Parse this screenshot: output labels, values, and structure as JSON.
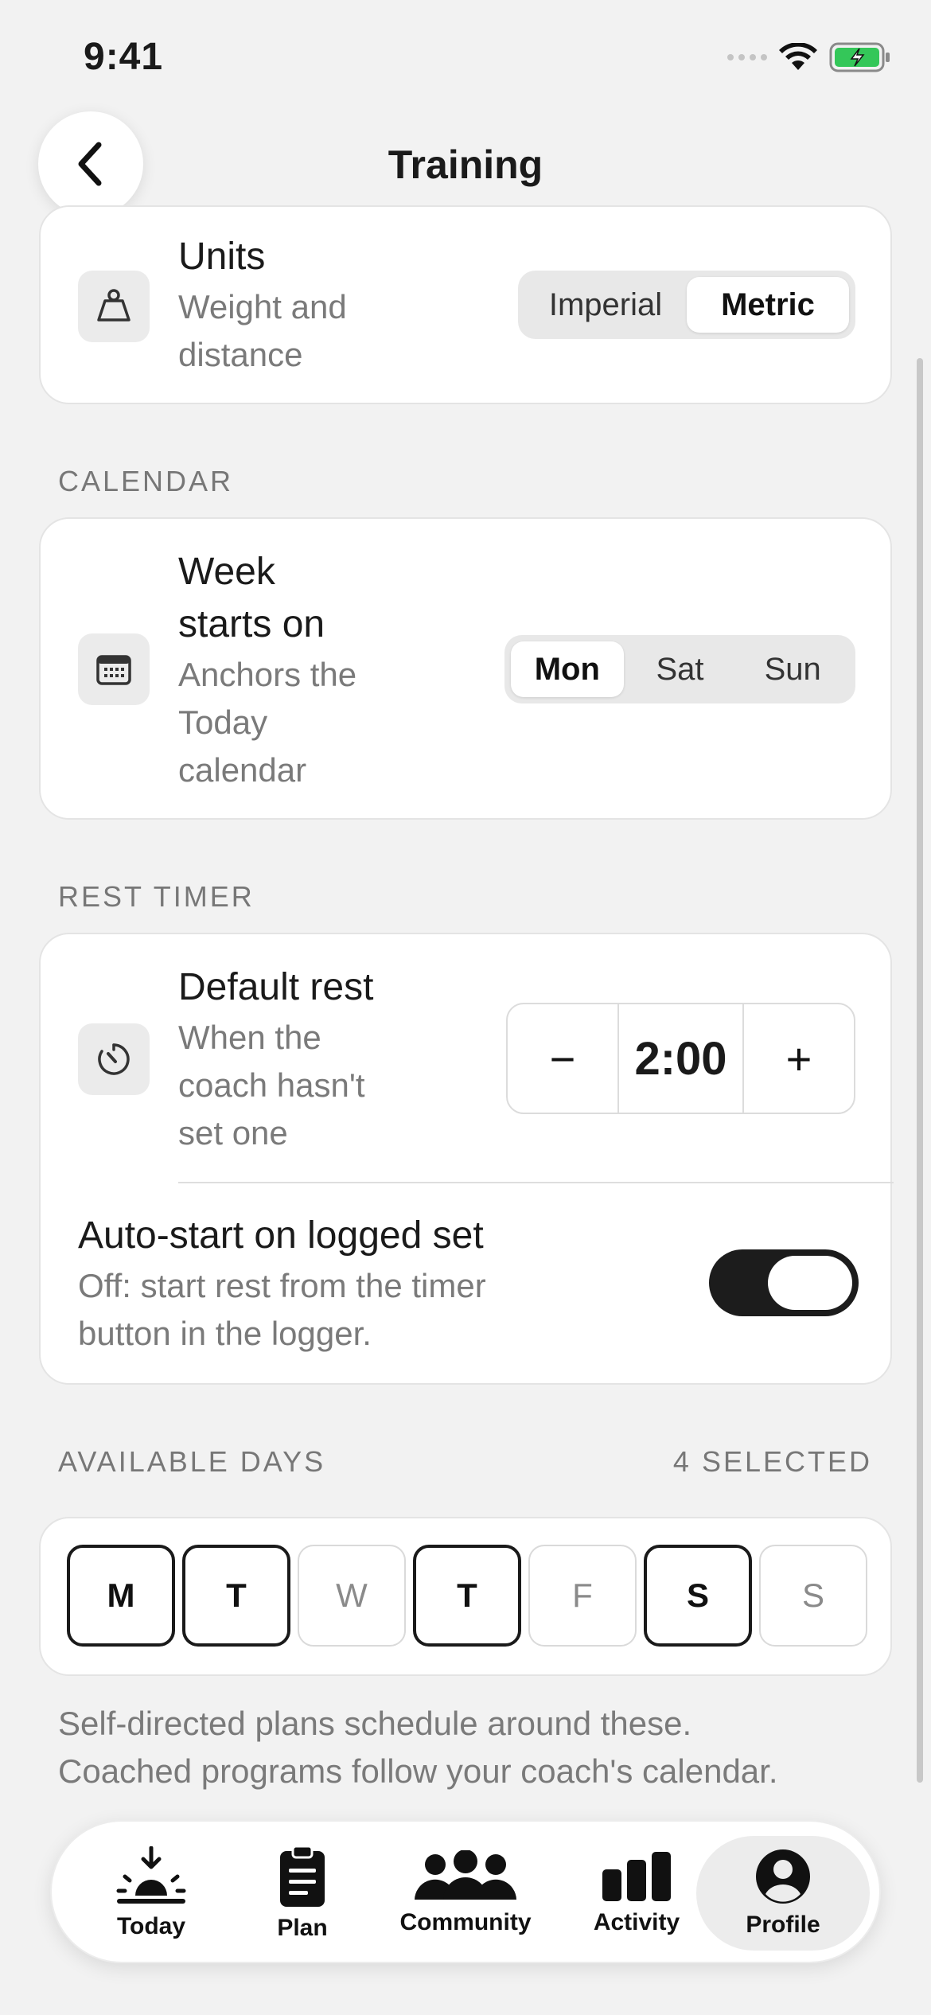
{
  "status": {
    "time": "9:41"
  },
  "header": {
    "title": "Training"
  },
  "units": {
    "title": "Units",
    "subtitle_line1": "Weight and",
    "subtitle_line2": "distance",
    "options": [
      "Imperial",
      "Metric"
    ],
    "selected": "Metric"
  },
  "calendar": {
    "section": "CALENDAR",
    "title_line1": "Week",
    "title_line2": "starts on",
    "subtitle_line1": "Anchors the",
    "subtitle_line2": "Today",
    "subtitle_line3": "calendar",
    "options": [
      "Mon",
      "Sat",
      "Sun"
    ],
    "selected": "Mon"
  },
  "rest_timer": {
    "section": "REST TIMER",
    "title": "Default rest",
    "subtitle_line1": "When the",
    "subtitle_line2": "coach hasn't",
    "subtitle_line3": "set one",
    "value": "2:00",
    "decrement": "−",
    "increment": "+",
    "auto_start_title": "Auto-start on logged set",
    "auto_start_sub_line1": "Off: start rest from the timer",
    "auto_start_sub_line2": "button in the logger.",
    "auto_start_on": true
  },
  "available_days": {
    "section": "AVAILABLE DAYS",
    "count_label": "4 SELECTED",
    "days": [
      {
        "label": "M",
        "selected": true
      },
      {
        "label": "T",
        "selected": true
      },
      {
        "label": "W",
        "selected": false
      },
      {
        "label": "T",
        "selected": true
      },
      {
        "label": "F",
        "selected": false
      },
      {
        "label": "S",
        "selected": true
      },
      {
        "label": "S",
        "selected": false
      }
    ],
    "footnote_line1": "Self-directed plans schedule around these.",
    "footnote_line2": "Coached programs follow your coach's calendar."
  },
  "tabbar": {
    "tabs": [
      {
        "label": "Today",
        "icon": "sunrise-icon"
      },
      {
        "label": "Plan",
        "icon": "clipboard-icon"
      },
      {
        "label": "Community",
        "icon": "people-icon"
      },
      {
        "label": "Activity",
        "icon": "bar-chart-icon"
      },
      {
        "label": "Profile",
        "icon": "person-icon"
      }
    ],
    "active": "Profile"
  }
}
